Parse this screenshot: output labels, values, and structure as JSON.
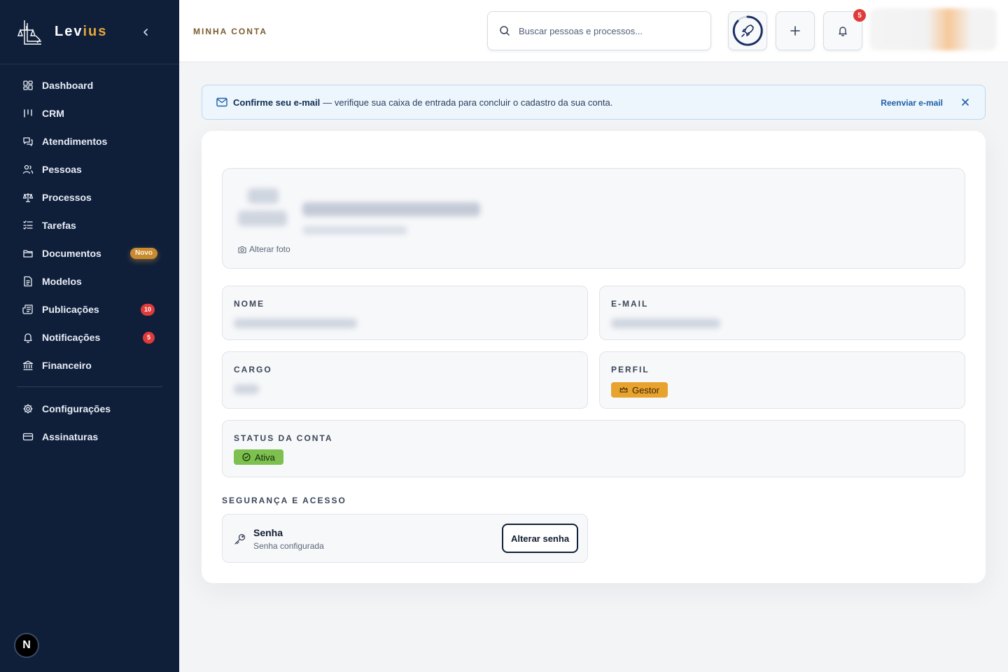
{
  "brand": {
    "name_prefix": "Lev",
    "name_suffix": "ius"
  },
  "sidebar": {
    "items": [
      {
        "label": "Dashboard",
        "icon": "dashboard-icon"
      },
      {
        "label": "CRM",
        "icon": "kanban-icon"
      },
      {
        "label": "Atendimentos",
        "icon": "chat-icon"
      },
      {
        "label": "Pessoas",
        "icon": "users-icon"
      },
      {
        "label": "Processos",
        "icon": "scale-icon"
      },
      {
        "label": "Tarefas",
        "icon": "tasks-icon"
      },
      {
        "label": "Documentos",
        "icon": "folder-icon",
        "badge": "Novo"
      },
      {
        "label": "Modelos",
        "icon": "file-text-icon"
      },
      {
        "label": "Publicações",
        "icon": "newspaper-icon",
        "badge": "10"
      },
      {
        "label": "Notificações",
        "icon": "bell-icon",
        "badge": "5"
      },
      {
        "label": "Financeiro",
        "icon": "bank-icon"
      }
    ],
    "secondary": [
      {
        "label": "Configurações",
        "icon": "gear-icon"
      },
      {
        "label": "Assinaturas",
        "icon": "credit-card-icon"
      }
    ],
    "footer_avatar": "N"
  },
  "header": {
    "title": "MINHA CONTA",
    "search_placeholder": "Buscar pessoas e processos...",
    "notifications_count": "5"
  },
  "banner": {
    "title": "Confirme seu e-mail",
    "message": "— verifique sua caixa de entrada para concluir o cadastro da sua conta.",
    "action": "Reenviar e-mail"
  },
  "profile": {
    "change_photo": "Alterar foto"
  },
  "fields": {
    "nome_label": "NOME",
    "email_label": "E-MAIL",
    "cargo_label": "CARGO",
    "perfil_label": "PERFIL",
    "perfil_value": "Gestor",
    "status_label": "STATUS DA CONTA",
    "status_value": "Ativa"
  },
  "security": {
    "section_title": "SEGURANÇA E ACESSO",
    "password_title": "Senha",
    "password_subtitle": "Senha configurada",
    "change_button": "Alterar senha"
  },
  "colors": {
    "sidebar_bg": "#0f1f3a",
    "accent_gold": "#e8a63a",
    "badge_red": "#e03a3a",
    "status_green": "#7ec04f"
  }
}
